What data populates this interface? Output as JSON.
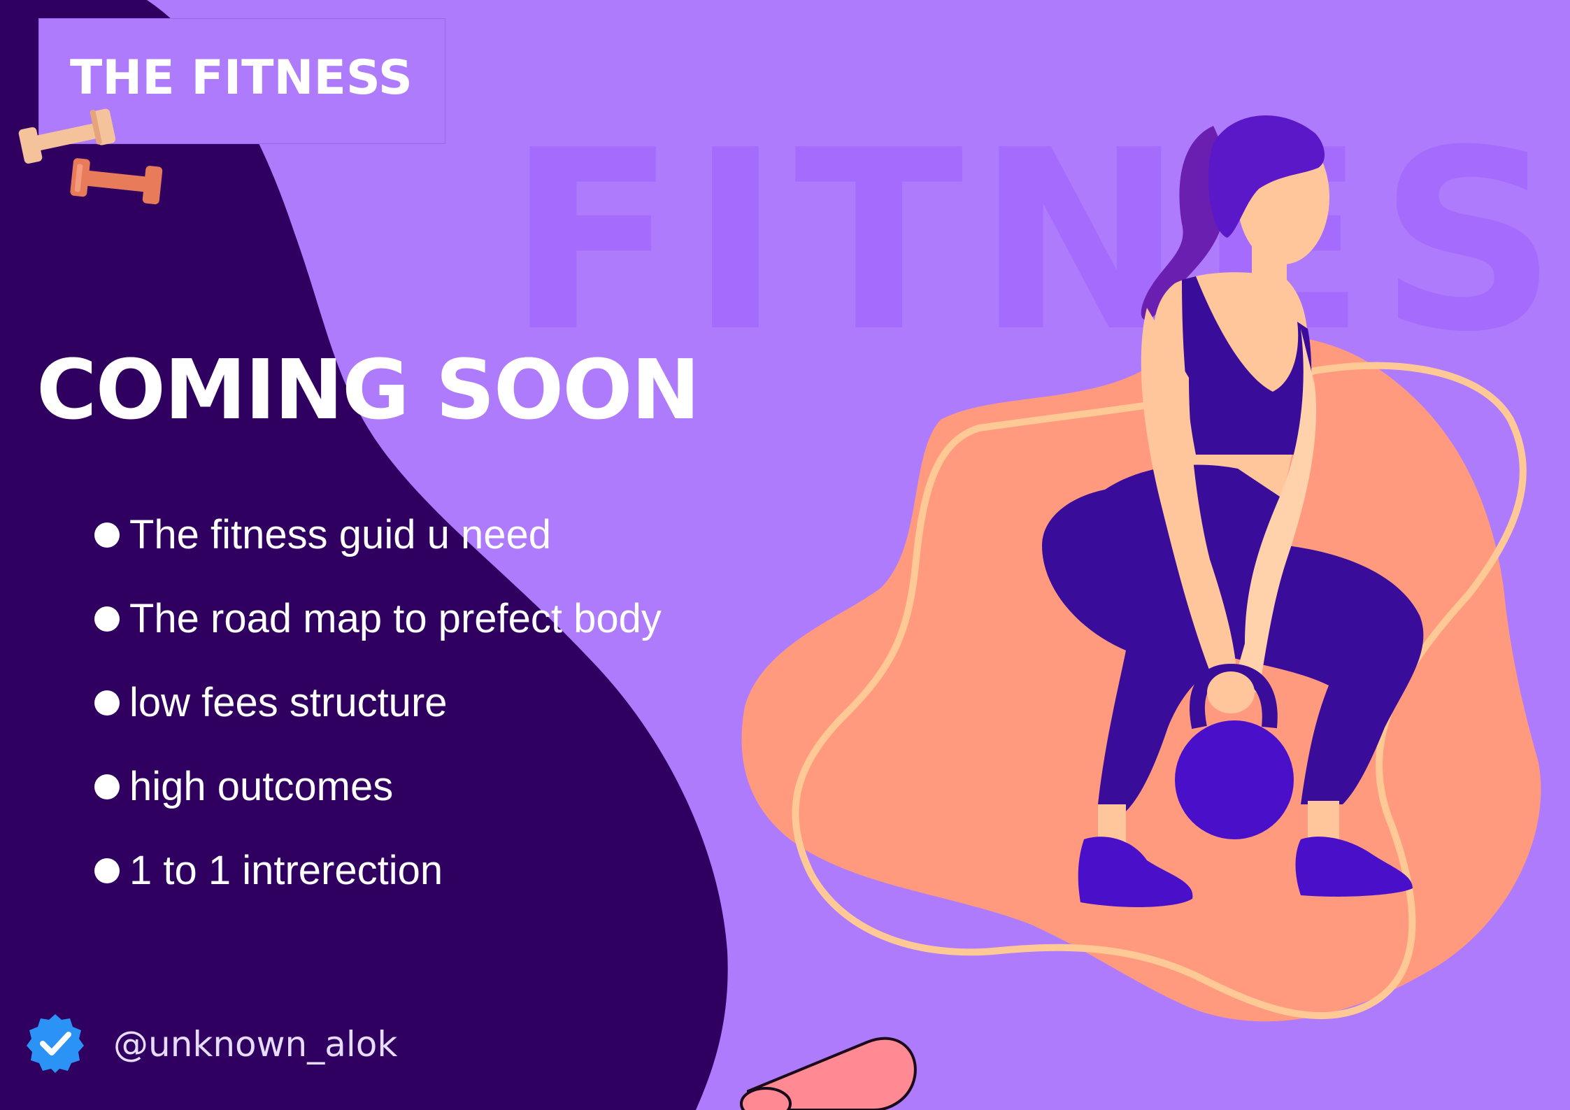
{
  "brand": {
    "title": "THE FITNESS"
  },
  "watermark": {
    "text": "FITNESS"
  },
  "headline": "COMING SOON",
  "features": [
    "The fitness guid u need",
    "The road map to prefect body",
    "low fees structure",
    "high outcomes",
    "1 to 1 intrerection"
  ],
  "footer": {
    "handle": "@unknown_alok",
    "icon": "verified-badge-icon"
  },
  "colors": {
    "background": "#ad7bfc",
    "dark_panel": "#300060",
    "blob": "#ff9a7f",
    "rope": "#ffc996",
    "outfit": "#3a0c9a",
    "skin": "#ffc69b",
    "badge": "#2a93f5"
  }
}
